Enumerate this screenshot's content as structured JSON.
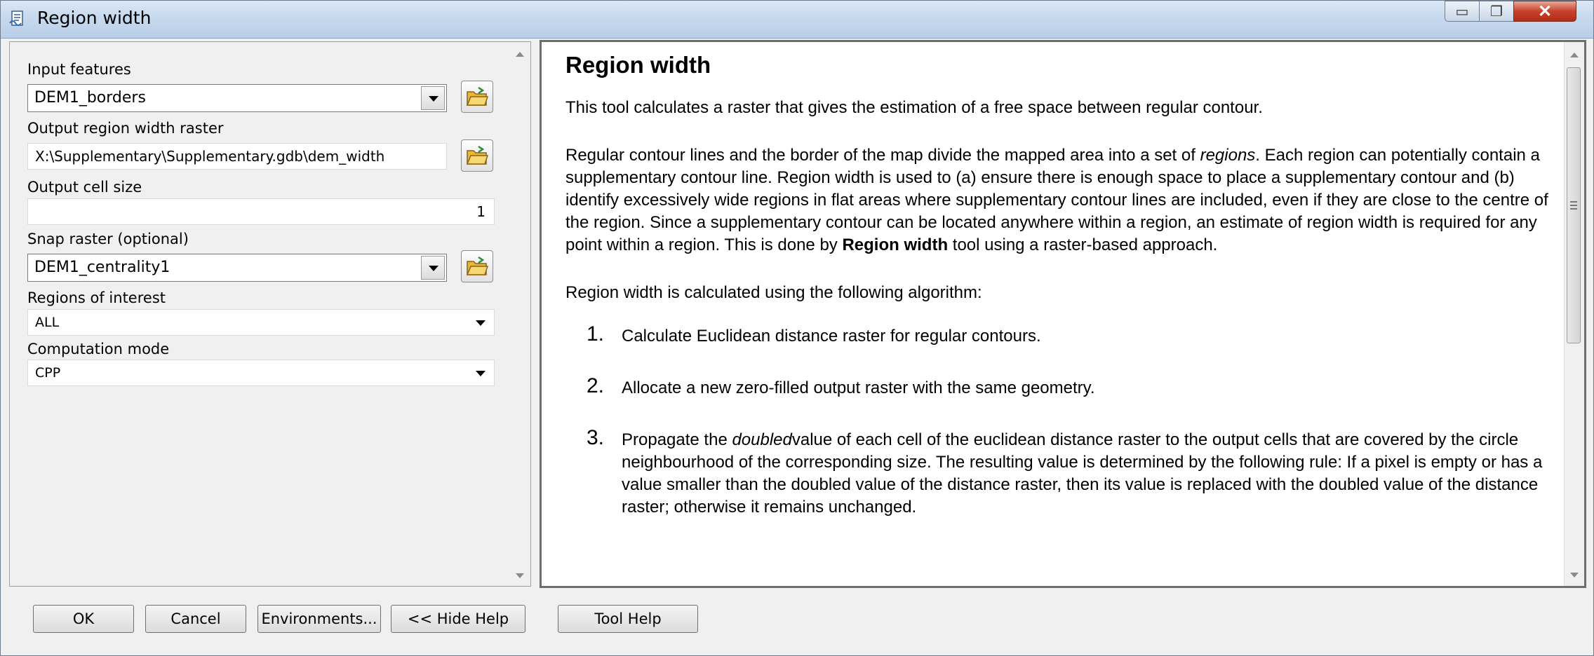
{
  "window": {
    "title": "Region width",
    "minimize_glyph": "▭",
    "maximize_glyph": "❐",
    "close_glyph": "✕"
  },
  "params": {
    "input_features": {
      "label": "Input features",
      "value": "DEM1_borders"
    },
    "output_raster": {
      "label": "Output region width raster",
      "value": "X:\\Supplementary\\Supplementary.gdb\\dem_width"
    },
    "output_cell_size": {
      "label": "Output cell size",
      "value": "1"
    },
    "snap_raster": {
      "label": "Snap raster (optional)",
      "value": "DEM1_centrality1"
    },
    "regions_of_interest": {
      "label": "Regions of interest",
      "value": "ALL"
    },
    "computation_mode": {
      "label": "Computation mode",
      "value": "CPP"
    }
  },
  "help": {
    "title": "Region width",
    "intro": "This tool calculates a raster that gives the estimation of a free space between regular contour.",
    "para2_a": "Regular contour lines and the border of the map divide the mapped area into a set of ",
    "para2_em": "regions",
    "para2_b": ". Each region can potentially contain a supplementary contour line. Region width is used to (a) ensure there is enough space to place a supplementary contour and (b) identify excessively wide regions in flat areas where supplementary contour lines are included, even if they are close to the centre of the region. Since a supplementary contour can be located anywhere within a region, an estimate of region width is required for any point within a region. This is done by ",
    "para2_strong": "Region width",
    "para2_c": " tool using a raster-based approach.",
    "algo_intro": "Region width is calculated using the following algorithm:",
    "steps": [
      {
        "num": "1.",
        "text": "Calculate Euclidean distance raster for regular contours."
      },
      {
        "num": "2.",
        "text": "Allocate a new zero-filled output raster with the same geometry."
      },
      {
        "num": "3.",
        "text_a": "Propagate the ",
        "text_em": "doubled",
        "text_b": "value of each cell of the euclidean distance raster to the output cells that are covered by the circle neighbourhood of the corresponding size. The resulting value is determined by the following rule: If a pixel is empty or has a value smaller than the doubled value of the distance raster, then its value is replaced with the doubled value of the distance raster; otherwise it remains unchanged."
      }
    ]
  },
  "buttons": {
    "ok": "OK",
    "cancel": "Cancel",
    "environments": "Environments...",
    "hide_help": "<< Hide Help",
    "tool_help": "Tool Help"
  },
  "icons": {
    "title": "tool-script-icon",
    "browse": "open-folder-icon"
  }
}
